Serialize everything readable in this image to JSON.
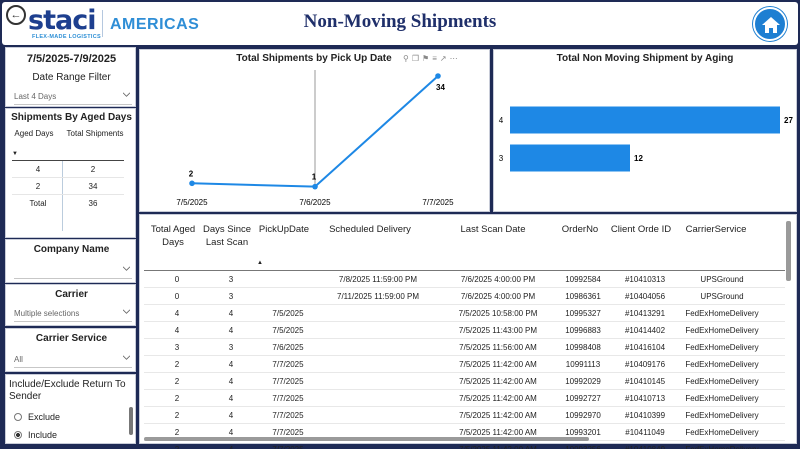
{
  "header": {
    "logo_text": "staci",
    "logo_tagline": "FLEX-MADE LOGISTICS",
    "region": "AMERICAS",
    "title": "Non-Moving Shipments"
  },
  "date_range": {
    "value": "7/5/2025-7/9/2025",
    "label": "Date Range Filter",
    "selected": "Last 4 Days"
  },
  "aged_table": {
    "title": "Shipments By Aged Days",
    "col1": "Aged Days",
    "col2": "Total Shipments",
    "rows": [
      {
        "days": "4",
        "total": "2"
      },
      {
        "days": "2",
        "total": "34"
      },
      {
        "days": "Total",
        "total": "36"
      }
    ]
  },
  "company": {
    "label": "Company Name",
    "selected": ""
  },
  "carrier": {
    "label": "Carrier",
    "selected": "Multiple selections"
  },
  "carrier_service": {
    "label": "Carrier Service",
    "selected": "All"
  },
  "include_exclude": {
    "label": "Include/Exclude Return To Sender",
    "options": [
      {
        "label": "Exclude",
        "selected": false
      },
      {
        "label": "Include",
        "selected": true
      }
    ]
  },
  "chart_data": [
    {
      "type": "line",
      "title": "Total Shipments by Pick Up Date",
      "categories": [
        "7/5/2025",
        "7/6/2025",
        "7/7/2025"
      ],
      "values": [
        2,
        1,
        34
      ],
      "ylim": [
        0,
        34
      ],
      "color": "#1e88e5"
    },
    {
      "type": "bar",
      "orientation": "horizontal",
      "title": "Total Non Moving Shipment by Aging",
      "categories": [
        "4",
        "3"
      ],
      "values": [
        27,
        12
      ],
      "color": "#1e88e5"
    }
  ],
  "table": {
    "columns": [
      "Total Aged Days",
      "Days Since Last Scan",
      "PickUpDate",
      "Scheduled Delivery",
      "Last Scan Date",
      "OrderNo",
      "Client Orde ID",
      "CarrierService"
    ],
    "rows": [
      [
        "0",
        "3",
        "",
        "7/8/2025 11:59:00 PM",
        "7/6/2025 4:00:00 PM",
        "10992584",
        "#10410313",
        "UPSGround"
      ],
      [
        "0",
        "3",
        "",
        "7/11/2025 11:59:00 PM",
        "7/6/2025 4:00:00 PM",
        "10986361",
        "#10404056",
        "UPSGround"
      ],
      [
        "4",
        "4",
        "7/5/2025",
        "",
        "7/5/2025 10:58:00 PM",
        "10995327",
        "#10413291",
        "FedExHomeDelivery"
      ],
      [
        "4",
        "4",
        "7/5/2025",
        "",
        "7/5/2025 11:43:00 PM",
        "10996883",
        "#10414402",
        "FedExHomeDelivery"
      ],
      [
        "3",
        "3",
        "7/6/2025",
        "",
        "7/5/2025 11:56:00 AM",
        "10998408",
        "#10416104",
        "FedExHomeDelivery"
      ],
      [
        "2",
        "4",
        "7/7/2025",
        "",
        "7/5/2025 11:42:00 AM",
        "10991113",
        "#10409176",
        "FedExHomeDelivery"
      ],
      [
        "2",
        "4",
        "7/7/2025",
        "",
        "7/5/2025 11:42:00 AM",
        "10992029",
        "#10410145",
        "FedExHomeDelivery"
      ],
      [
        "2",
        "4",
        "7/7/2025",
        "",
        "7/5/2025 11:42:00 AM",
        "10992727",
        "#10410713",
        "FedExHomeDelivery"
      ],
      [
        "2",
        "4",
        "7/7/2025",
        "",
        "7/5/2025 11:42:00 AM",
        "10992970",
        "#10410399",
        "FedExHomeDelivery"
      ],
      [
        "2",
        "4",
        "7/7/2025",
        "",
        "7/5/2025 11:42:00 AM",
        "10993201",
        "#10411049",
        "FedExHomeDelivery"
      ],
      [
        "2",
        "4",
        "7/7/2025",
        "",
        "7/5/2025 11:42:00 AM",
        "10993256",
        "#10410849",
        "FedExHomeDelivery"
      ]
    ]
  }
}
